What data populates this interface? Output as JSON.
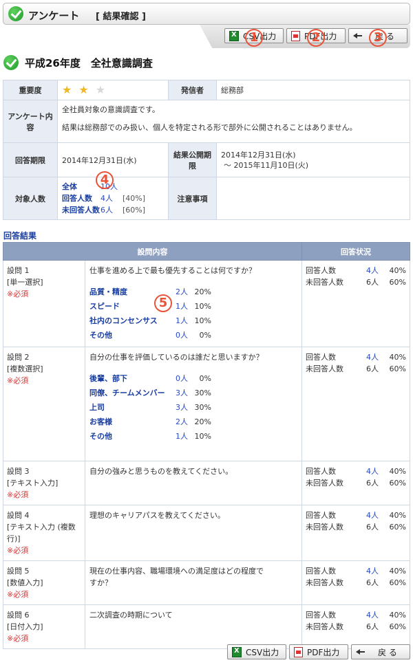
{
  "header": {
    "title": "アンケート",
    "subtitle": "[ 結果確認 ]"
  },
  "toolbar": {
    "csv_label": "CSV出力",
    "pdf_label": "PDF出力",
    "back_label": "戻 る"
  },
  "markers": {
    "m1": "1",
    "m2": "2",
    "m3": "3",
    "m4": "4",
    "m5": "5"
  },
  "survey": {
    "title": "平成26年度　全社意識調査",
    "importance_label": "重要度",
    "importance_stars": 2,
    "importance_max": 3,
    "sender_label": "発信者",
    "sender": "総務部",
    "content_label": "アンケート内容",
    "content_line1": "全社員対象の意識調査です。",
    "content_line2": "結果は総務部でのみ扱い、個人を特定される形で部外に公開されることはありません。",
    "deadline_label": "回答期限",
    "deadline": "2014年12月31日(水)",
    "publish_label": "結果公開期限",
    "publish_from": "2014年12月31日(水)",
    "publish_to": "～ 2015年11月10日(火)",
    "target_label": "対象人数",
    "total_label": "全体",
    "total_count": "10人",
    "answered_label": "回答人数",
    "answered_count": "4人",
    "answered_pct": "[40%]",
    "unanswered_label": "未回答人数",
    "unanswered_count": "6人",
    "unanswered_pct": "[60%]",
    "notes_label": "注意事項",
    "notes": ""
  },
  "results": {
    "section_title": "回答結果",
    "col_question": "設問内容",
    "col_status": "回答状況",
    "answered_label": "回答人数",
    "unanswered_label": "未回答人数",
    "questions": [
      {
        "no": "設問 1",
        "type": "[単一選択]",
        "required": "※必須",
        "text": "仕事を進める上で最も優先することは何ですか？",
        "options": [
          {
            "label": "品質・精度",
            "count": "2人",
            "pct": "20%"
          },
          {
            "label": "スピード",
            "count": "1人",
            "pct": "10%"
          },
          {
            "label": "社内のコンセンサス",
            "count": "1人",
            "pct": "10%"
          },
          {
            "label": "その他",
            "count": "0人",
            "pct": "0%"
          }
        ],
        "answered": "4人",
        "answered_pct": "40%",
        "unanswered": "6人",
        "unanswered_pct": "60%"
      },
      {
        "no": "設問 2",
        "type": "[複数選択]",
        "required": "※必須",
        "text": "自分の仕事を評価しているのは誰だと思いますか？",
        "options": [
          {
            "label": "後輩、部下",
            "count": "0人",
            "pct": "0%"
          },
          {
            "label": "同僚、チームメンバー",
            "count": "3人",
            "pct": "30%"
          },
          {
            "label": "上司",
            "count": "3人",
            "pct": "30%"
          },
          {
            "label": "お客様",
            "count": "2人",
            "pct": "20%"
          },
          {
            "label": "その他",
            "count": "1人",
            "pct": "10%"
          }
        ],
        "answered": "4人",
        "answered_pct": "40%",
        "unanswered": "6人",
        "unanswered_pct": "60%"
      },
      {
        "no": "設問 3",
        "type": "[テキスト入力]",
        "required": "※必須",
        "text": "自分の強みと思うものを教えてください。",
        "answered": "4人",
        "answered_pct": "40%",
        "unanswered": "6人",
        "unanswered_pct": "60%"
      },
      {
        "no": "設問 4",
        "type": "[テキスト入力 (複数行)]",
        "required": "※必須",
        "text": "理想のキャリアパスを教えてください。",
        "answered": "4人",
        "answered_pct": "40%",
        "unanswered": "6人",
        "unanswered_pct": "60%"
      },
      {
        "no": "設問 5",
        "type": "[数値入力]",
        "required": "※必須",
        "text": "現在の仕事内容、職場環境への満足度はどの程度ですか？",
        "answered": "4人",
        "answered_pct": "40%",
        "unanswered": "6人",
        "unanswered_pct": "60%"
      },
      {
        "no": "設問 6",
        "type": "[日付入力]",
        "required": "※必須",
        "text": "二次調査の時期について",
        "answered": "4人",
        "answered_pct": "40%",
        "unanswered": "6人",
        "unanswered_pct": "60%"
      }
    ]
  }
}
